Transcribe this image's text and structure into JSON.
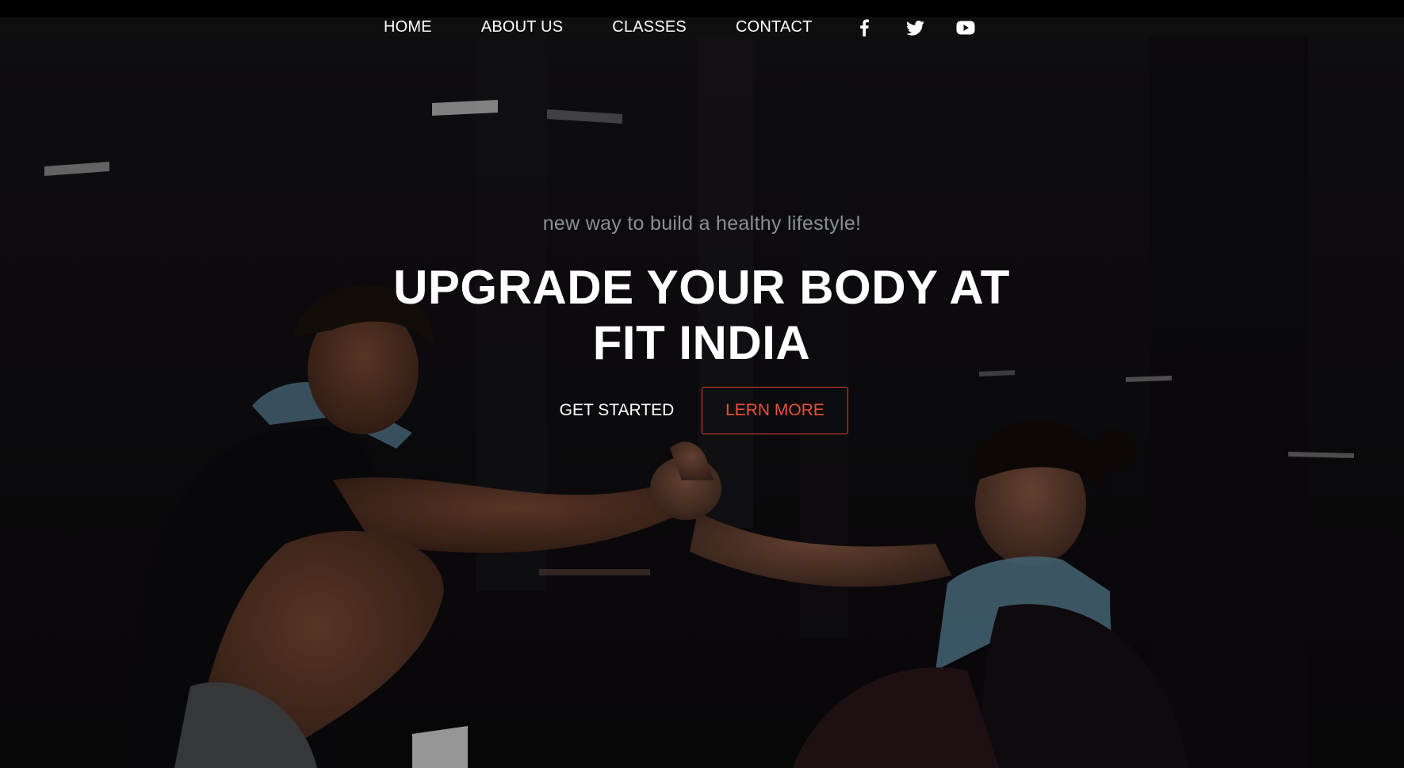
{
  "nav": {
    "links": [
      {
        "label": "HOME"
      },
      {
        "label": "ABOUT US"
      },
      {
        "label": "CLASSES"
      },
      {
        "label": "CONTACT"
      }
    ],
    "social": [
      "facebook-icon",
      "twitter-icon",
      "youtube-icon"
    ]
  },
  "hero": {
    "tagline": "new way to build a healthy lifestyle!",
    "headline_line1": "UPGRADE YOUR BODY AT",
    "headline_line2": "FIT INDIA",
    "primary_button": "GET STARTED",
    "secondary_button": "LERN MORE",
    "background_image": "two-people-gym-handshake-photo"
  },
  "colors": {
    "accent": "#e8513c",
    "nav_bg": "#0f0f10",
    "text": "#ffffff",
    "tagline": "#8a9093"
  }
}
